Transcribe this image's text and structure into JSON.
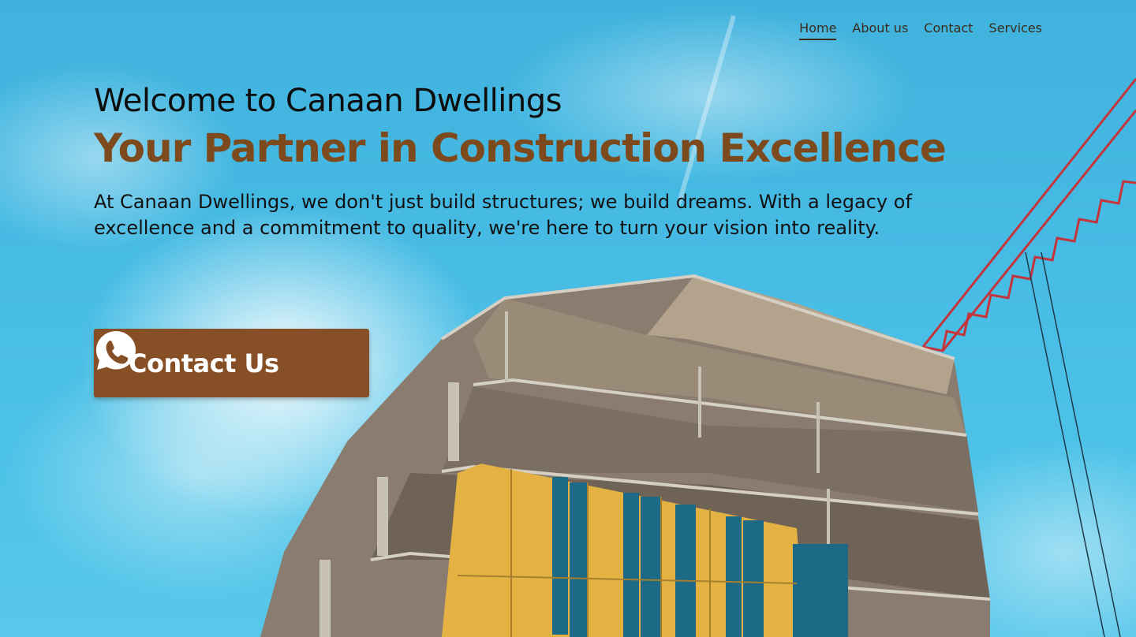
{
  "nav": {
    "items": [
      {
        "label": "Home",
        "active": true
      },
      {
        "label": "About us",
        "active": false
      },
      {
        "label": "Contact",
        "active": false
      },
      {
        "label": "Services",
        "active": false
      }
    ]
  },
  "hero": {
    "welcome": "Welcome to Canaan Dwellings",
    "tagline": "Your Partner in Construction Excellence",
    "description": "At Canaan Dwellings, we don't just build structures; we build dreams. With a legacy of excellence and a commitment to quality, we're here to turn your vision into reality.",
    "cta_label": "Contact Us",
    "cta_icon": "whatsapp-icon"
  },
  "colors": {
    "accent": "#874f26",
    "tagline": "#7d4a1e",
    "sky": "#46bbe4"
  }
}
